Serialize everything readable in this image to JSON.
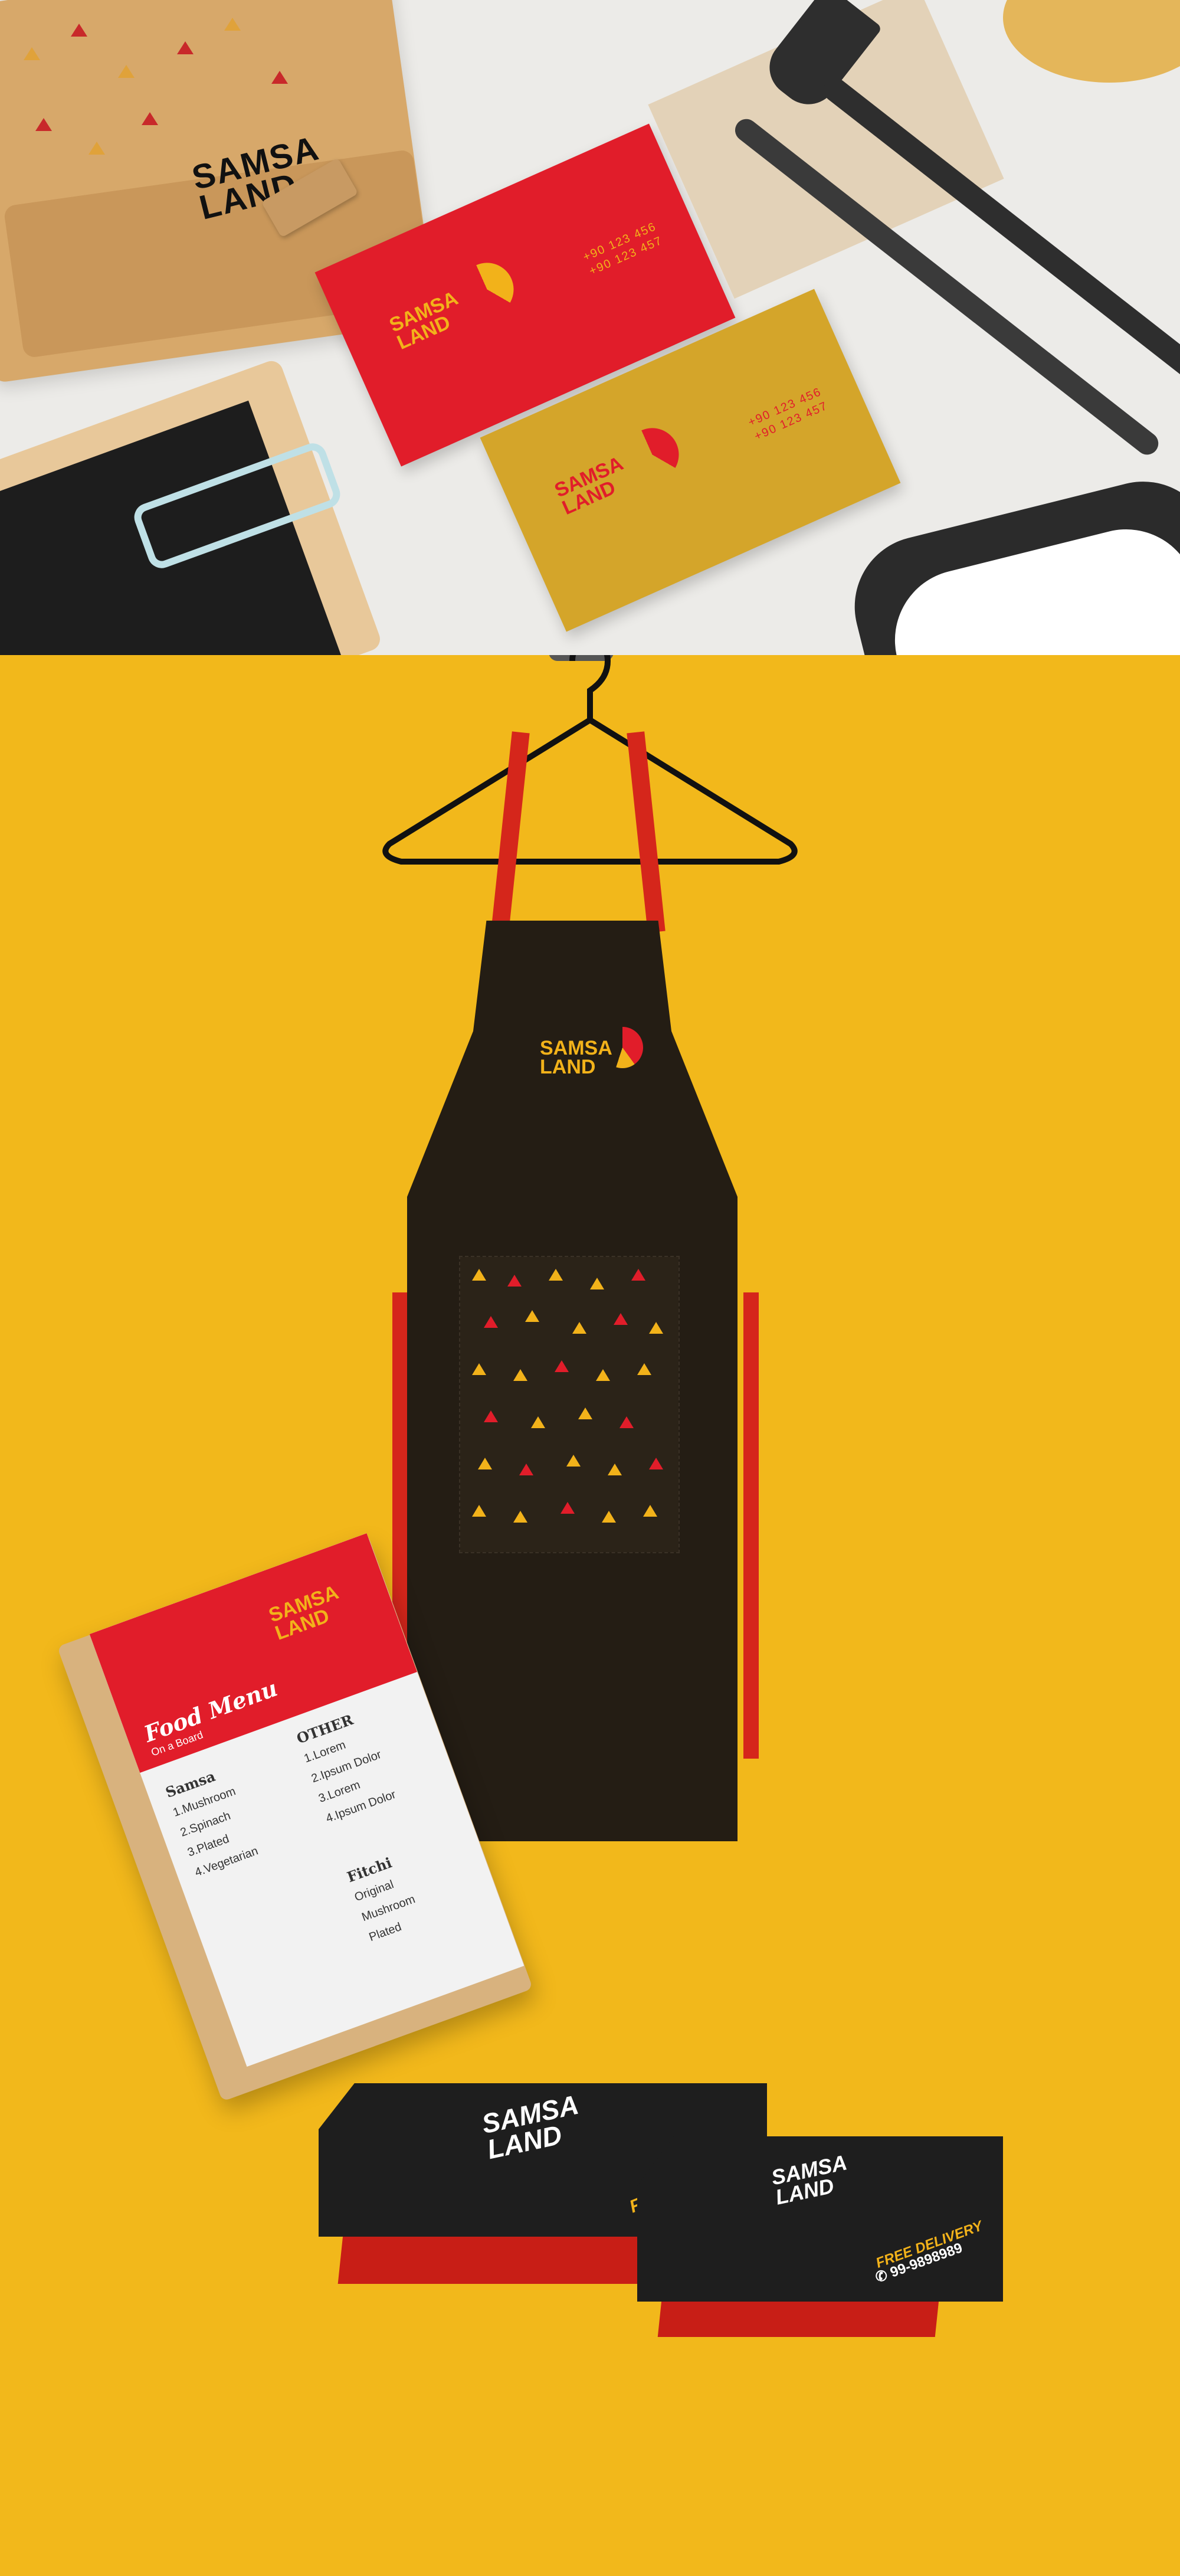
{
  "brand": {
    "name_line1": "SAMSA",
    "name_line2": "LAND"
  },
  "colors": {
    "yellow": "#f2b81b",
    "red": "#e11d2a",
    "dark": "#241d14",
    "gold": "#d4a52a"
  },
  "business_cards": [
    {
      "phone1": "+90 123 456",
      "phone2": "+90 123 457"
    },
    {
      "phone1": "+90 123 456",
      "phone2": "+90 123 457"
    }
  ],
  "menu": {
    "title": "Food Menu",
    "subtitle": "On a Board",
    "section1": "Samsa",
    "items1": [
      "1.Mushroom",
      "2.Spinach",
      "3.Plated",
      "4.Vegetarian"
    ],
    "section2": "OTHER",
    "items2": [
      "1.Lorem",
      "2.Ipsum Dolor",
      "3.Lorem",
      "4.Ipsum Dolor"
    ],
    "section3": "Fitchi",
    "items3": [
      "Original",
      "Mushroom",
      "Plated"
    ]
  },
  "boxes": {
    "large": {
      "delivery": "FREE DELIVERY"
    },
    "small": {
      "delivery": "FREE DELIVERY",
      "phone": "99-9898989"
    }
  },
  "icons": [
    "hanger-icon",
    "hook-icon",
    "fork-icon",
    "knife-icon",
    "phone-icon"
  ]
}
